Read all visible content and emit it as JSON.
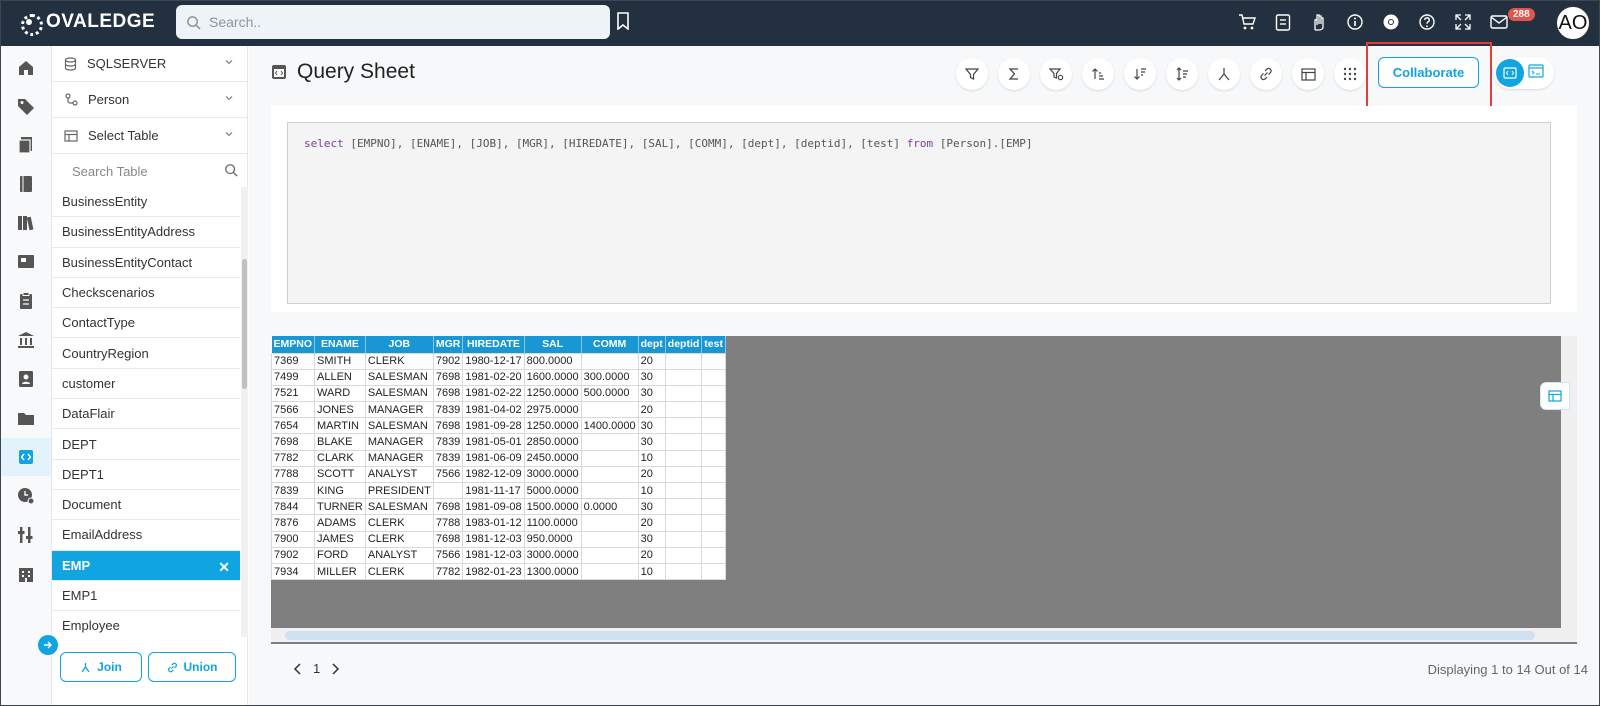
{
  "app": {
    "logo_text": "OVALEDGE"
  },
  "topbar": {
    "search_placeholder": "Search..",
    "notification_count": "288",
    "avatar_initials": "AO"
  },
  "sidebar": {
    "connection": "SQLSERVER",
    "schema": "Person",
    "table_select": "Select Table",
    "search_placeholder": "Search Table",
    "tables": [
      "BusinessEntity",
      "BusinessEntityAddress",
      "BusinessEntityContact",
      "Checkscenarios",
      "ContactType",
      "CountryRegion",
      "customer",
      "DataFlair",
      "DEPT",
      "DEPT1",
      "Document",
      "EmailAddress",
      "EMP",
      "EMP1",
      "Employee"
    ],
    "selected_table": "EMP",
    "join_label": "Join",
    "union_label": "Union"
  },
  "main": {
    "title": "Query Sheet",
    "collaborate_label": "Collaborate",
    "query": {
      "kw_select": "select",
      "cols": "[EMPNO], [ENAME], [JOB], [MGR], [HIREDATE], [SAL], [COMM], [dept], [deptid], [test]",
      "kw_from": "from",
      "target": "[Person].[EMP]"
    },
    "grid": {
      "columns": [
        "EMPNO",
        "ENAME",
        "JOB",
        "MGR",
        "HIREDATE",
        "SAL",
        "COMM",
        "dept",
        "deptid",
        "test"
      ],
      "rows": [
        [
          "7369",
          "SMITH",
          "CLERK",
          "7902",
          "1980-12-17",
          "800.0000",
          "",
          "20",
          "",
          ""
        ],
        [
          "7499",
          "ALLEN",
          "SALESMAN",
          "7698",
          "1981-02-20",
          "1600.0000",
          "300.0000",
          "30",
          "",
          ""
        ],
        [
          "7521",
          "WARD",
          "SALESMAN",
          "7698",
          "1981-02-22",
          "1250.0000",
          "500.0000",
          "30",
          "",
          ""
        ],
        [
          "7566",
          "JONES",
          "MANAGER",
          "7839",
          "1981-04-02",
          "2975.0000",
          "",
          "20",
          "",
          ""
        ],
        [
          "7654",
          "MARTIN",
          "SALESMAN",
          "7698",
          "1981-09-28",
          "1250.0000",
          "1400.0000",
          "30",
          "",
          ""
        ],
        [
          "7698",
          "BLAKE",
          "MANAGER",
          "7839",
          "1981-05-01",
          "2850.0000",
          "",
          "30",
          "",
          ""
        ],
        [
          "7782",
          "CLARK",
          "MANAGER",
          "7839",
          "1981-06-09",
          "2450.0000",
          "",
          "10",
          "",
          ""
        ],
        [
          "7788",
          "SCOTT",
          "ANALYST",
          "7566",
          "1982-12-09",
          "3000.0000",
          "",
          "20",
          "",
          ""
        ],
        [
          "7839",
          "KING",
          "PRESIDENT",
          "",
          "1981-11-17",
          "5000.0000",
          "",
          "10",
          "",
          ""
        ],
        [
          "7844",
          "TURNER",
          "SALESMAN",
          "7698",
          "1981-09-08",
          "1500.0000",
          "0.0000",
          "30",
          "",
          ""
        ],
        [
          "7876",
          "ADAMS",
          "CLERK",
          "7788",
          "1983-01-12",
          "1100.0000",
          "",
          "20",
          "",
          ""
        ],
        [
          "7900",
          "JAMES",
          "CLERK",
          "7698",
          "1981-12-03",
          "950.0000",
          "",
          "30",
          "",
          ""
        ],
        [
          "7902",
          "FORD",
          "ANALYST",
          "7566",
          "1981-12-03",
          "3000.0000",
          "",
          "20",
          "",
          ""
        ],
        [
          "7934",
          "MILLER",
          "CLERK",
          "7782",
          "1982-01-23",
          "1300.0000",
          "",
          "10",
          "",
          ""
        ]
      ]
    },
    "pager": {
      "page": "1"
    },
    "footer_count": "Displaying 1 to 14 Out of 14"
  },
  "colors": {
    "accent": "#10a4e0",
    "topbar": "#23303f",
    "highlight": "#e43b3b"
  }
}
